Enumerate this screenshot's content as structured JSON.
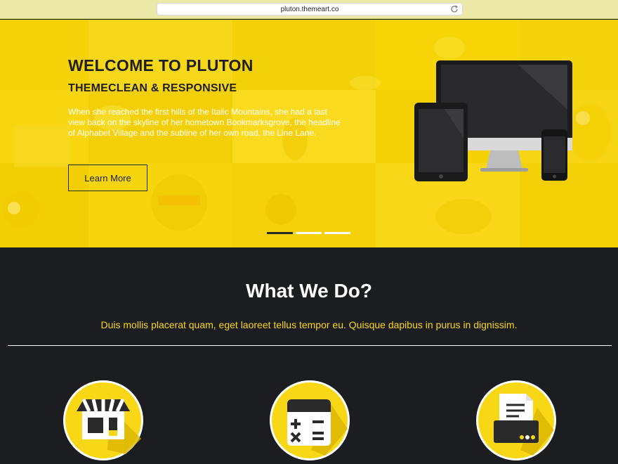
{
  "browser": {
    "url": "pluton.themeart.co"
  },
  "hero": {
    "title": "WELCOME TO PLUTON",
    "subtitle": "THEMECLEAN & RESPONSIVE",
    "text": "When she reached the first hills of the Italic Mountains, she had a last view back on the skyline of her hometown Bookmarksgrove, the headline of Alphabet Village and the subline of her own road, the Line Lane.",
    "button_label": "Learn More",
    "slides": {
      "count": 3,
      "active": 1
    }
  },
  "services_section": {
    "title": "What We Do?",
    "subtitle": "Duis mollis placerat quam, eget laoreet tellus tempor eu. Quisque dapibus in purus in dignissim.",
    "icons": [
      "shop-icon",
      "calculator-icon",
      "printer-icon"
    ]
  },
  "colors": {
    "accent": "#f7d716",
    "dark_bg": "#1c1d21",
    "text_dark": "#1f1f1f"
  }
}
